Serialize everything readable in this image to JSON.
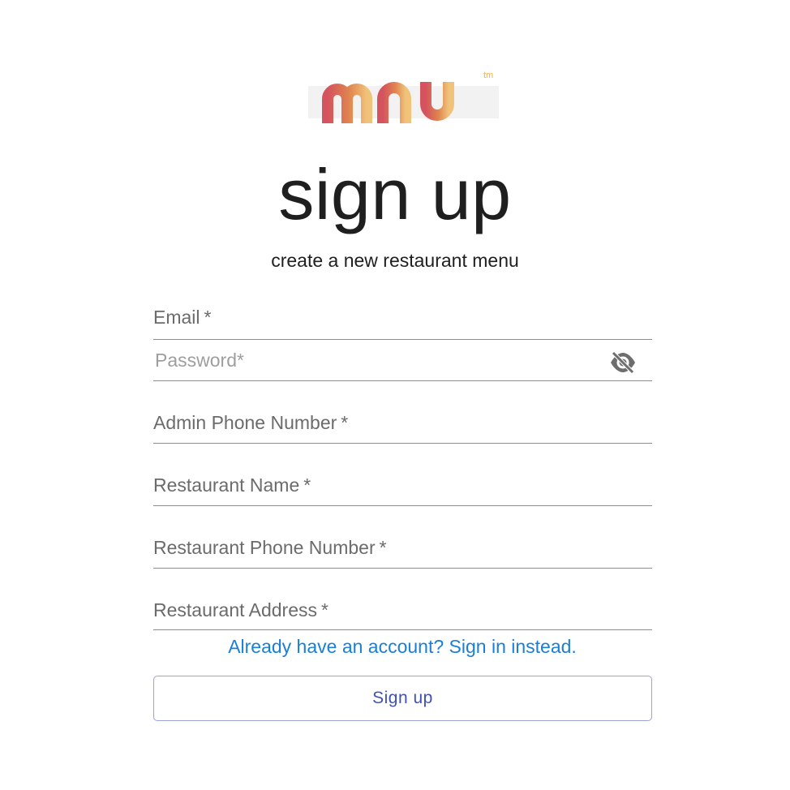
{
  "logo": {
    "text": "mnu",
    "trademark": "tm",
    "colors": [
      "#d4535e",
      "#e8a05a",
      "#f0c27a"
    ]
  },
  "heading": {
    "title": "sign up",
    "subtitle": "create a new restaurant menu"
  },
  "form": {
    "email": {
      "label": "Email",
      "required_mark": "*"
    },
    "password": {
      "placeholder": "Password*",
      "toggle_icon": "eye-slash-icon"
    },
    "admin_phone": {
      "label": "Admin Phone Number",
      "required_mark": "*"
    },
    "restaurant_name": {
      "label": "Restaurant Name",
      "required_mark": "*"
    },
    "restaurant_phone": {
      "label": "Restaurant Phone Number",
      "required_mark": "*"
    },
    "restaurant_address": {
      "label": "Restaurant Address",
      "required_mark": "*"
    }
  },
  "signin_link": "Already have an account? Sign in instead.",
  "submit_label": "Sign up",
  "colors": {
    "link": "#1a7fd6",
    "button_text": "#3f51b5",
    "button_border": "#9aa4d6"
  }
}
